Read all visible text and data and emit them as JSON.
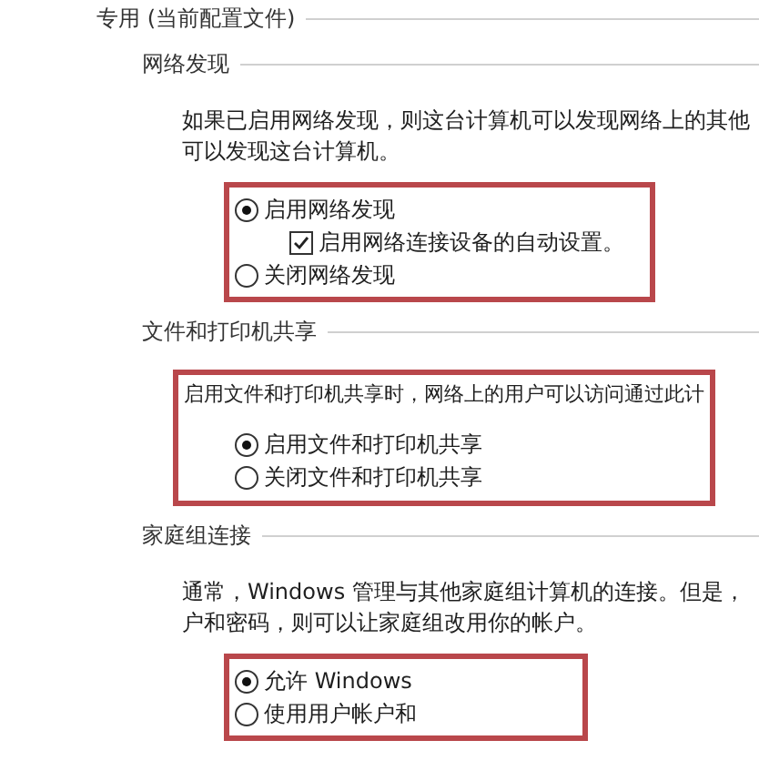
{
  "profile": {
    "title": "专用 (当前配置文件)"
  },
  "sections": [
    {
      "title": "网络发现",
      "description_lines": [
        "如果已启用网络发现，则这台计算机可以发现网络上的其他",
        "可以发现这台计算机。"
      ],
      "description_framed": false,
      "options_framed": true,
      "options": [
        {
          "kind": "radio",
          "label": "启用网络发现",
          "selected": true,
          "children": [
            {
              "kind": "checkbox",
              "label": "启用网络连接设备的自动设置。",
              "checked": true
            }
          ]
        },
        {
          "kind": "radio",
          "label": "关闭网络发现",
          "selected": false
        }
      ]
    },
    {
      "title": "文件和打印机共享",
      "description_lines": [
        "启用文件和打印机共享时，网络上的用户可以访问通过此计"
      ],
      "description_framed": true,
      "options_framed": false,
      "options": [
        {
          "kind": "radio",
          "label": "启用文件和打印机共享",
          "selected": true
        },
        {
          "kind": "radio",
          "label": "关闭文件和打印机共享",
          "selected": false
        }
      ]
    },
    {
      "title": "家庭组连接",
      "description_lines": [
        "通常，Windows 管理与其他家庭组计算机的连接。但是，",
        "户和密码，则可以让家庭组改用你的帐户。"
      ],
      "description_framed": false,
      "options_framed": true,
      "options": [
        {
          "kind": "radio",
          "label": "允许 Windows",
          "selected": true
        },
        {
          "kind": "radio",
          "label": "使用用户帐户和",
          "selected": false
        }
      ]
    }
  ]
}
